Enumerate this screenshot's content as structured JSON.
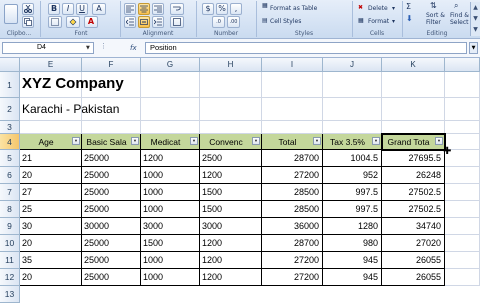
{
  "ribbon": {
    "groups": [
      {
        "id": "clipboard",
        "label": "Clipbo..."
      },
      {
        "id": "font",
        "label": "Font"
      },
      {
        "id": "alignment",
        "label": "Alignment"
      },
      {
        "id": "number",
        "label": "Number"
      },
      {
        "id": "styles",
        "label": "Styles"
      },
      {
        "id": "cells",
        "label": "Cells"
      },
      {
        "id": "editing",
        "label": "Editing"
      }
    ],
    "styles_items": [
      "Format as Table",
      "Cell Styles"
    ],
    "cells_items": [
      "Delete",
      "Format"
    ],
    "editing_items": [
      "Sort &",
      "Filter",
      "Find &",
      "Select"
    ],
    "number_symbols": [
      "$",
      "%",
      ","
    ]
  },
  "formula_bar": {
    "name_box": "D4",
    "fx_label": "fx",
    "formula": "Position"
  },
  "columns": [
    "E",
    "F",
    "G",
    "H",
    "I",
    "J",
    "K"
  ],
  "rows": [
    "1",
    "2",
    "3",
    "4",
    "5",
    "6",
    "7",
    "8",
    "9",
    "10",
    "11",
    "12",
    "13"
  ],
  "sheet": {
    "title": "XYZ Company",
    "subtitle": "Karachi - Pakistan",
    "headers": [
      "Age",
      "Basic Sala",
      "Medicat",
      "Convenc",
      "Total",
      "Tax 3.5%",
      "Grand Tota"
    ],
    "data": [
      [
        "21",
        "25000",
        "1200",
        "2500",
        "28700",
        "1004.5",
        "27695.5"
      ],
      [
        "20",
        "25000",
        "1000",
        "1200",
        "27200",
        "952",
        "26248"
      ],
      [
        "27",
        "25000",
        "1000",
        "1500",
        "28500",
        "997.5",
        "27502.5"
      ],
      [
        "25",
        "25000",
        "1000",
        "1500",
        "28500",
        "997.5",
        "27502.5"
      ],
      [
        "30",
        "30000",
        "3000",
        "3000",
        "36000",
        "1280",
        "34740"
      ],
      [
        "20",
        "25000",
        "1500",
        "1200",
        "28700",
        "980",
        "27020"
      ],
      [
        "35",
        "25000",
        "1000",
        "1200",
        "27200",
        "945",
        "26055"
      ],
      [
        "20",
        "25000",
        "1000",
        "1200",
        "27200",
        "945",
        "26055"
      ]
    ]
  },
  "colors": {
    "header_fill": "#c4d79b",
    "selection": "#f5c66c"
  }
}
